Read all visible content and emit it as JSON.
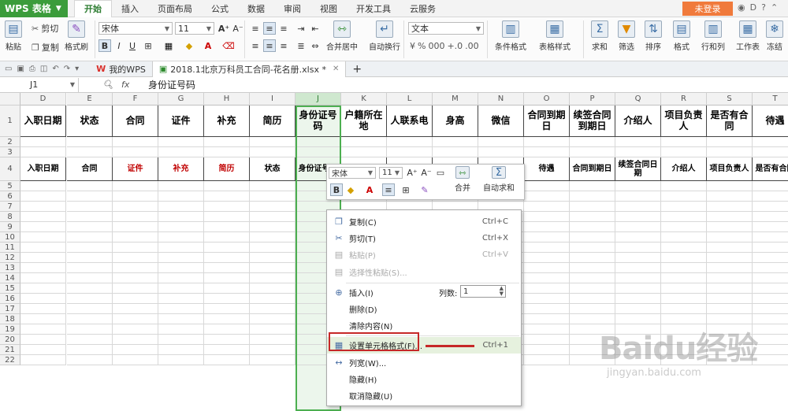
{
  "menubar": {
    "app_name": "WPS 表格",
    "tabs": [
      "开始",
      "插入",
      "页面布局",
      "公式",
      "数据",
      "审阅",
      "视图",
      "开发工具",
      "云服务"
    ],
    "login": "未登录"
  },
  "ribbon": {
    "paste": "粘贴",
    "cut": "剪切",
    "copy": "复制",
    "format_painter": "格式刷",
    "font": "宋体",
    "font_size": "11",
    "merge": "合并居中",
    "wrap": "自动换行",
    "number_format": "文本",
    "cond_format": "条件格式",
    "table_style": "表格样式",
    "sum": "求和",
    "filter": "筛选",
    "sort": "排序",
    "format": "格式",
    "rowcol": "行和列",
    "worksheet": "工作表",
    "freeze": "冻结"
  },
  "doctabs": {
    "home": "我的WPS",
    "file": "2018.1北京万科员工合同-花名册.xlsx *"
  },
  "formula_bar": {
    "cell_ref": "J1",
    "fx": "fx",
    "value": "身份证号码"
  },
  "columns": [
    "D",
    "E",
    "F",
    "G",
    "H",
    "I",
    "J",
    "K",
    "L",
    "M",
    "N",
    "O",
    "P",
    "Q",
    "R",
    "S",
    "T"
  ],
  "rows": [
    "1",
    "2",
    "3",
    "4",
    "5",
    "6",
    "7",
    "8",
    "9",
    "10",
    "11",
    "12",
    "13",
    "14",
    "15",
    "16",
    "17",
    "18",
    "19",
    "20",
    "21",
    "22"
  ],
  "row1": [
    "入职日期",
    "状态",
    "合同",
    "证件",
    "补充",
    "简历",
    "身份证号码",
    "户籍所在地",
    "人联系电",
    "身高",
    "微信",
    "合同到期日",
    "续签合同到期日",
    "介绍人",
    "项目负责人",
    "是否有合同",
    "待遇"
  ],
  "row4": [
    "入职日期",
    "合同",
    "证件",
    "补充",
    "简历",
    "状态",
    "身份证号码",
    "",
    "",
    "",
    "",
    "待遇",
    "合同到期日",
    "续签合同日期",
    "介绍人",
    "项目负责人",
    "是否有合同"
  ],
  "mini_toolbar": {
    "font": "宋体",
    "size": "11",
    "merge": "合并",
    "autosum": "自动求和"
  },
  "context_menu": {
    "items": [
      {
        "label": "复制(C)",
        "shortcut": "Ctrl+C"
      },
      {
        "label": "剪切(T)",
        "shortcut": "Ctrl+X"
      },
      {
        "label": "粘贴(P)",
        "shortcut": "Ctrl+V"
      },
      {
        "label": "选择性粘贴(S)...",
        "shortcut": ""
      },
      {
        "label": "插入(I)",
        "shortcut": ""
      },
      {
        "label": "删除(D)",
        "shortcut": ""
      },
      {
        "label": "清除内容(N)",
        "shortcut": ""
      },
      {
        "label": "设置单元格格式(F)...",
        "shortcut": "Ctrl+1"
      },
      {
        "label": "列宽(W)...",
        "shortcut": ""
      },
      {
        "label": "隐藏(H)",
        "shortcut": ""
      },
      {
        "label": "取消隐藏(U)",
        "shortcut": ""
      }
    ],
    "col_count_label": "列数:",
    "col_count_value": "1"
  },
  "watermark": {
    "brand": "Baidu经验",
    "url": "jingyan.baidu.com"
  }
}
